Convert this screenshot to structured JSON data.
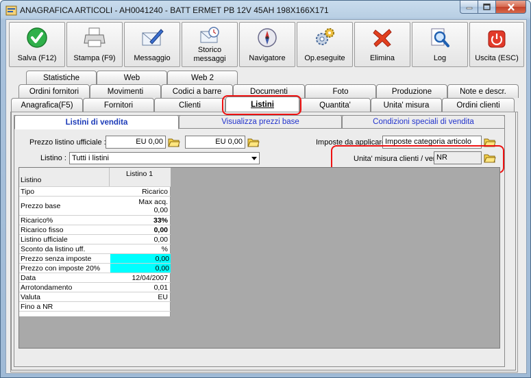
{
  "window": {
    "title": "ANAGRAFICA ARTICOLI - AH0041240 - BATT ERMET PB 12V 45AH 198X166X171"
  },
  "toolbar": {
    "buttons": [
      {
        "label": "Salva (F12)",
        "icon": "check-icon"
      },
      {
        "label": "Stampa (F9)",
        "icon": "printer-icon"
      },
      {
        "label": "Messaggio",
        "icon": "envelope-pen-icon"
      },
      {
        "label": "Storico messaggi",
        "icon": "envelope-history-icon"
      },
      {
        "label": "Navigatore",
        "icon": "compass-icon"
      },
      {
        "label": "Op.eseguite",
        "icon": "gears-icon"
      },
      {
        "label": "Elimina",
        "icon": "red-x-icon"
      },
      {
        "label": "Log",
        "icon": "log-search-icon"
      },
      {
        "label": "Uscita (ESC)",
        "icon": "power-icon"
      }
    ]
  },
  "tabs": {
    "row1": [
      "Statistiche",
      "Web",
      "Web 2"
    ],
    "row2": [
      "Ordini fornitori",
      "Movimenti",
      "Codici a barre",
      "Documenti",
      "Foto",
      "Produzione",
      "Note e descr."
    ],
    "row3": [
      "Anagrafica(F5)",
      "Fornitori",
      "Clienti",
      "Listini",
      "Quantita'",
      "Unita' misura",
      "Ordini clienti"
    ],
    "active": "Listini"
  },
  "subtabs": [
    "Listini di vendita",
    "Visualizza prezzi base",
    "Condizioni speciali di vendita"
  ],
  "form": {
    "prezzo_label": "Prezzo listino ufficiale :",
    "prezzo_value1": "EU 0,00",
    "prezzo_value2": "EU 0,00",
    "listino_label": "Listino :",
    "listino_value": "Tutti i listini",
    "imposte_label": "Imposte da applicare :",
    "imposte_value": "Imposte categoria articolo",
    "um_label": "Unita' misura clienti / vendita :",
    "um_value": "NR"
  },
  "grid": {
    "header_left": "Listino",
    "header_right": "Listino 1",
    "rows": [
      {
        "label": "Tipo",
        "value": "Ricarico"
      },
      {
        "label": "Prezzo base",
        "value": "Max acq.\n0,00"
      },
      {
        "label": "Ricarico%",
        "value": "33%"
      },
      {
        "label": "Ricarico fisso",
        "value": "0,00"
      },
      {
        "label": "Listino ufficiale",
        "value": "0,00"
      },
      {
        "label": "Sconto da listino uff.",
        "value": "%"
      },
      {
        "label": "Prezzo senza imposte",
        "value": "0,00"
      },
      {
        "label": "Prezzo con imposte 20%",
        "value": "0,00"
      },
      {
        "label": "Data",
        "value": "12/04/2007"
      },
      {
        "label": "Arrotondamento",
        "value": "0,01"
      },
      {
        "label": "Valuta",
        "value": "EU"
      },
      {
        "label": "Fino a NR",
        "value": ""
      }
    ]
  },
  "colors": {
    "highlight": "#ee1111",
    "cyan_cell": "#00ffff",
    "subtab_text": "#2233cc"
  }
}
